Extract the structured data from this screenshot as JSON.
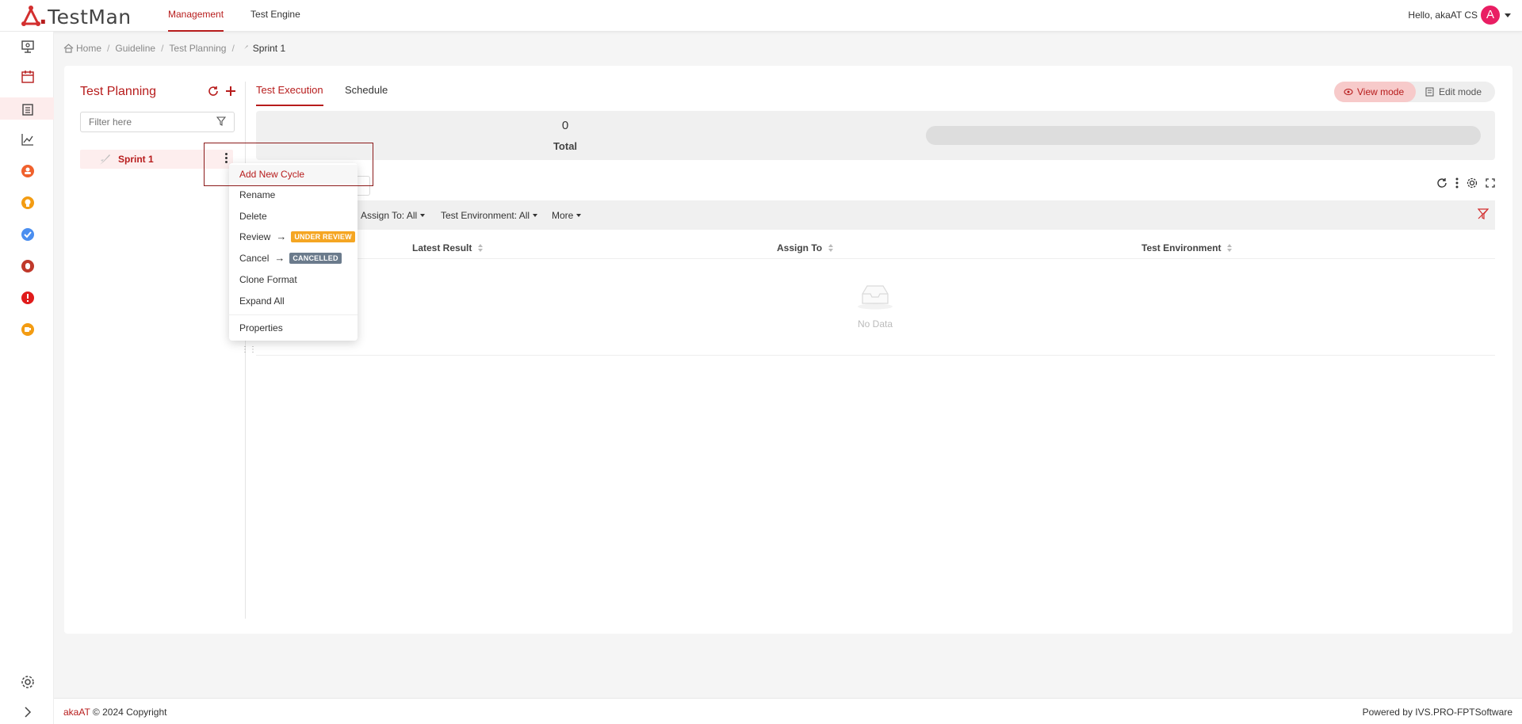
{
  "app": {
    "name_prefix": "",
    "name_accent": ".",
    "name_rest": "TestMan"
  },
  "topnav": {
    "items": [
      "Management",
      "Test Engine"
    ],
    "active": "Management"
  },
  "user": {
    "greeting": "Hello, akaAT CS",
    "avatar_letter": "A"
  },
  "breadcrumb": {
    "items": [
      "Home",
      "Guideline",
      "Test Planning",
      "Sprint 1"
    ]
  },
  "planning": {
    "title": "Test Planning",
    "filter_placeholder": "Filter here",
    "tree": [
      {
        "label": "Sprint 1"
      }
    ]
  },
  "tabs": {
    "items": [
      "Test Execution",
      "Schedule"
    ],
    "active": "Test Execution"
  },
  "modes": {
    "view": "View mode",
    "edit": "Edit mode",
    "active": "View mode"
  },
  "summary": {
    "count": "0",
    "label": "Total"
  },
  "filters": {
    "assign_to": "Assign To: All",
    "test_environment": "Test Environment: All",
    "more": "More"
  },
  "table": {
    "columns": [
      "Latest Result",
      "Assign To",
      "Test Environment"
    ],
    "empty_text": "No Data"
  },
  "context_menu": {
    "items": [
      {
        "label": "Add New Cycle"
      },
      {
        "label": "Rename"
      },
      {
        "label": "Delete"
      },
      {
        "label": "Review",
        "badge": "UNDER REVIEW",
        "badge_color": "#f5a623"
      },
      {
        "label": "Cancel",
        "badge": "CANCELLED",
        "badge_color": "#6b7b8c"
      },
      {
        "label": "Clone Format"
      },
      {
        "label": "Expand All"
      },
      {
        "label": "Properties"
      }
    ]
  },
  "footer": {
    "brand": "akaAT",
    "copyright": "© 2024 Copyright",
    "powered": "Powered by IVS.PRO-FPTSoftware"
  },
  "colors": {
    "accent": "#b71c1c",
    "badge_review": "#f5a623",
    "badge_cancel": "#6b7b8c"
  }
}
